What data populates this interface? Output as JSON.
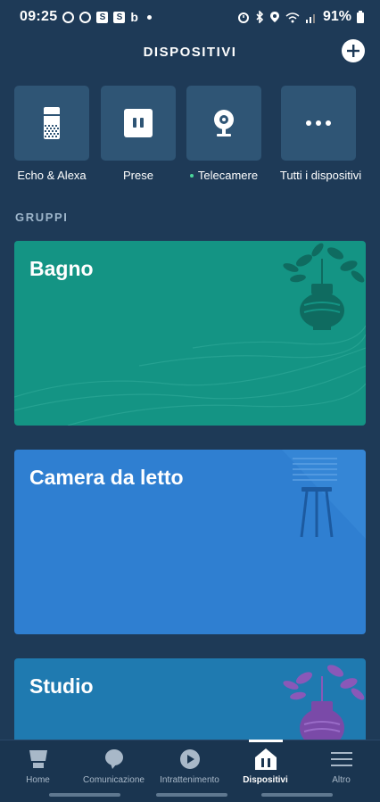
{
  "status_bar": {
    "time": "09:25",
    "battery": "91%"
  },
  "header": {
    "title": "DISPOSITIVI"
  },
  "tiles": [
    {
      "label": "Echo & Alexa",
      "icon": "echo-device-icon",
      "has_dot": false
    },
    {
      "label": "Prese",
      "icon": "plug-icon",
      "has_dot": false
    },
    {
      "label": "Telecamere",
      "icon": "camera-icon",
      "has_dot": true
    },
    {
      "label": "Tutti i dispositivi",
      "icon": "more-icon",
      "has_dot": true
    }
  ],
  "section": {
    "groups_label": "GRUPPI"
  },
  "groups": [
    {
      "name": "Bagno",
      "color": "#149484"
    },
    {
      "name": "Camera da letto",
      "color": "#2f7fd1"
    },
    {
      "name": "Studio",
      "color": "#1f7ab0"
    }
  ],
  "bottom_nav": {
    "items": [
      {
        "label": "Home",
        "icon": "home-icon",
        "active": false
      },
      {
        "label": "Comunicazione",
        "icon": "chat-bubble-icon",
        "active": false
      },
      {
        "label": "Intrattenimento",
        "icon": "play-icon",
        "active": false
      },
      {
        "label": "Dispositivi",
        "icon": "devices-icon",
        "active": true
      },
      {
        "label": "Altro",
        "icon": "menu-icon",
        "active": false
      }
    ]
  },
  "colors": {
    "background": "#1e3a57",
    "tile": "#2f5575",
    "accent_dot": "#4ad59a"
  }
}
